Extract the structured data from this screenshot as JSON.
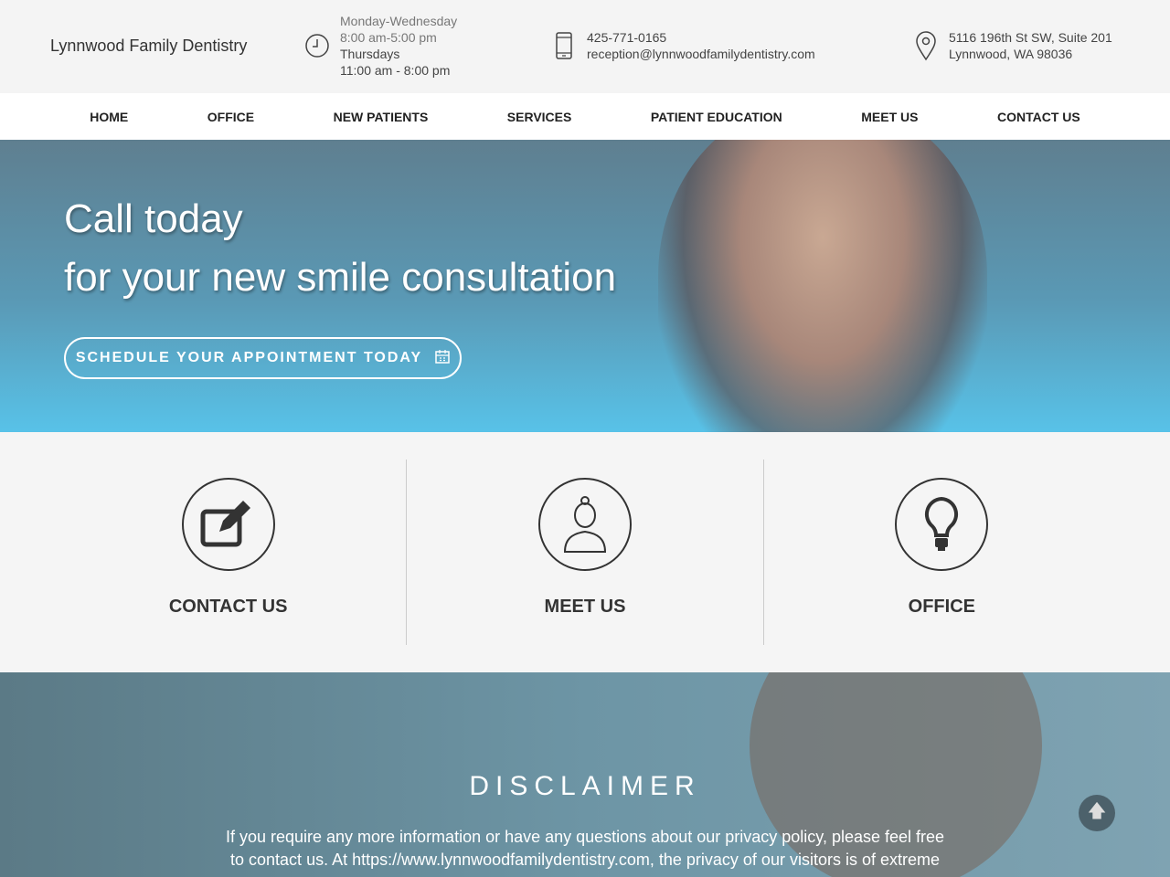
{
  "header": {
    "brand": "Lynnwood Family Dentistry",
    "hours": [
      "Monday-Wednesday",
      "8:00 am-5:00 pm",
      "Thursdays",
      "11:00 am - 8:00 pm"
    ],
    "phone": "425-771-0165",
    "email": "reception@lynnwoodfamilydentistry.com",
    "address": [
      "5116 196th St SW, Suite 201",
      "Lynnwood, WA 98036"
    ]
  },
  "nav": [
    "HOME",
    "OFFICE",
    "NEW PATIENTS",
    "SERVICES",
    "PATIENT EDUCATION",
    "MEET US",
    "CONTACT US"
  ],
  "hero": {
    "line1": "Call today",
    "line2": "for your new smile consultation",
    "cta": "SCHEDULE YOUR APPOINTMENT TODAY"
  },
  "cards": [
    {
      "label": "CONTACT US",
      "icon": "edit-icon"
    },
    {
      "label": "MEET US",
      "icon": "doctor-icon"
    },
    {
      "label": "OFFICE",
      "icon": "lightbulb-icon"
    }
  ],
  "disclaimer": {
    "title": "DISCLAIMER",
    "text": "If you require any more information or have any questions about our privacy policy, please feel free to contact us. At https://www.lynnwoodfamilydentistry.com, the privacy of our visitors is of extreme"
  }
}
